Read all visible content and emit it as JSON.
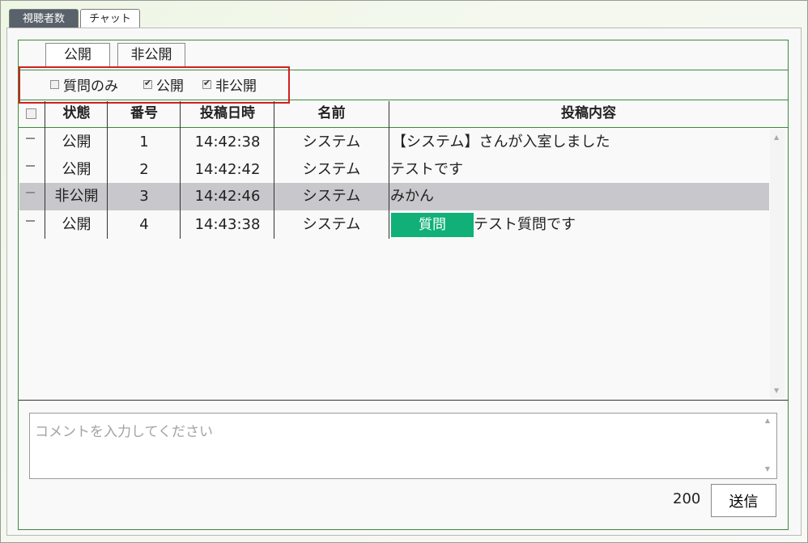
{
  "tabs": [
    {
      "label": "視聴者数"
    },
    {
      "label": "チャット"
    }
  ],
  "filter_tabs": {
    "public": "公開",
    "private": "非公開"
  },
  "filters": [
    {
      "label": "質問のみ",
      "checked": false
    },
    {
      "label": "公開",
      "checked": true
    },
    {
      "label": "非公開",
      "checked": true
    }
  ],
  "table": {
    "headers": {
      "status": "状態",
      "number": "番号",
      "time": "投稿日時",
      "name": "名前",
      "content": "投稿内容"
    },
    "rows": [
      {
        "status": "公開",
        "number": "1",
        "time": "14:42:38",
        "name": "システム",
        "content": "【システム】さんが入室しました",
        "badge": "",
        "selected": false
      },
      {
        "status": "公開",
        "number": "2",
        "time": "14:42:42",
        "name": "システム",
        "content": "テストです",
        "badge": "",
        "selected": false
      },
      {
        "status": "非公開",
        "number": "3",
        "time": "14:42:46",
        "name": "システム",
        "content": "みかん",
        "badge": "",
        "selected": true
      },
      {
        "status": "公開",
        "number": "4",
        "time": "14:43:38",
        "name": "システム",
        "content": "テスト質問です",
        "badge": "質問",
        "selected": false
      }
    ]
  },
  "comment": {
    "placeholder": "コメントを入力してください",
    "value": ""
  },
  "counter": "200",
  "send_label": "送信",
  "colors": {
    "border_green": "#3c8a3c",
    "badge_green": "#11b079",
    "highlight_red": "#d12020",
    "selected_row": "#c8c8cc"
  }
}
